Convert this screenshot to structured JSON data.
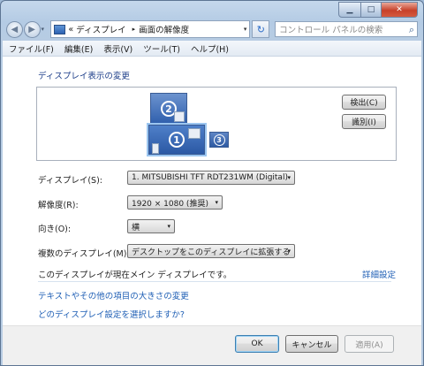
{
  "window": {
    "caption": {
      "minimize_glyph": "▁",
      "maximize_glyph": "□",
      "close_glyph": "✕"
    }
  },
  "address_bar": {
    "back_glyph": "◀",
    "forward_glyph": "▶",
    "chevron": "«",
    "crumbs": [
      "ディスプレイ",
      "画面の解像度"
    ],
    "separator": "▸",
    "dropdown_glyph": "▾",
    "refresh_glyph": "↻"
  },
  "search": {
    "placeholder": "コントロール パネルの検索",
    "icon_glyph": "⌕"
  },
  "menu": [
    "ファイル(F)",
    "編集(E)",
    "表示(V)",
    "ツール(T)",
    "ヘルプ(H)"
  ],
  "page": {
    "heading": "ディスプレイ表示の変更",
    "monitors": [
      {
        "number": "2"
      },
      {
        "number": "1",
        "selected": true
      },
      {
        "number": "3"
      }
    ],
    "detect_label": "検出(C)",
    "identify_label": "識別(I)",
    "fields": [
      {
        "label": "ディスプレイ(S):",
        "value": "1. MITSUBISHI TFT RDT231WM (Digital)"
      },
      {
        "label": "解像度(R):",
        "value": "1920 × 1080 (推奨)"
      },
      {
        "label": "向き(O):",
        "value": "横"
      },
      {
        "label": "複数のディスプレイ(M):",
        "value": "デスクトップをこのディスプレイに拡張する"
      }
    ],
    "main_display_text": "このディスプレイが現在メイン ディスプレイです。",
    "advanced_link": "詳細設定",
    "link_text_size": "テキストやその他の項目の大きさの変更",
    "link_which_settings": "どのディスプレイ設定を選択しますか?",
    "combo_arrow": "▾"
  },
  "footer": {
    "ok_label": "OK",
    "cancel_label": "キャンセル",
    "apply_label": "適用(A)"
  }
}
